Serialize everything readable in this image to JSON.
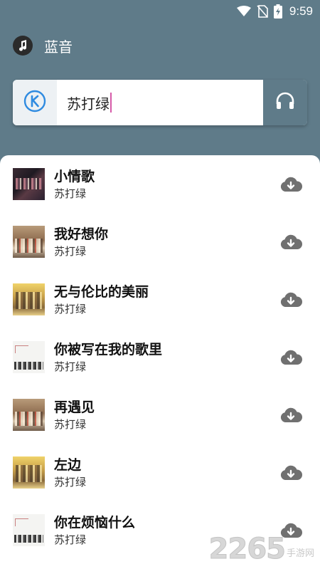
{
  "status_bar": {
    "time": "9:59",
    "icons": [
      "wifi-icon",
      "no-sim-icon",
      "battery-charging-icon"
    ]
  },
  "app": {
    "title": "蓝音",
    "logo_icon": "music-note-icon"
  },
  "search": {
    "value": "苏打绿",
    "source_icon": "kugou-k-icon",
    "listen_icon": "headphones-icon"
  },
  "songs": [
    {
      "title": "小情歌",
      "artist": "苏打绿",
      "cover": "dark"
    },
    {
      "title": "我好想你",
      "artist": "苏打绿",
      "cover": "street"
    },
    {
      "title": "无与伦比的美丽",
      "artist": "苏打绿",
      "cover": "yellow"
    },
    {
      "title": "你被写在我的歌里",
      "artist": "苏打绿",
      "cover": "white"
    },
    {
      "title": "再遇见",
      "artist": "苏打绿",
      "cover": "street"
    },
    {
      "title": "左边",
      "artist": "苏打绿",
      "cover": "yellow"
    },
    {
      "title": "你在烦恼什么",
      "artist": "苏打绿",
      "cover": "white"
    }
  ],
  "download_icon": "cloud-download-icon",
  "watermark": {
    "digits": "2265",
    "sub": "手游网"
  },
  "colors": {
    "header_bg": "#5f7b89",
    "source_icon_blue": "#2f8be0",
    "cursor_pink": "#d65aa8",
    "download_gray": "#707070"
  }
}
